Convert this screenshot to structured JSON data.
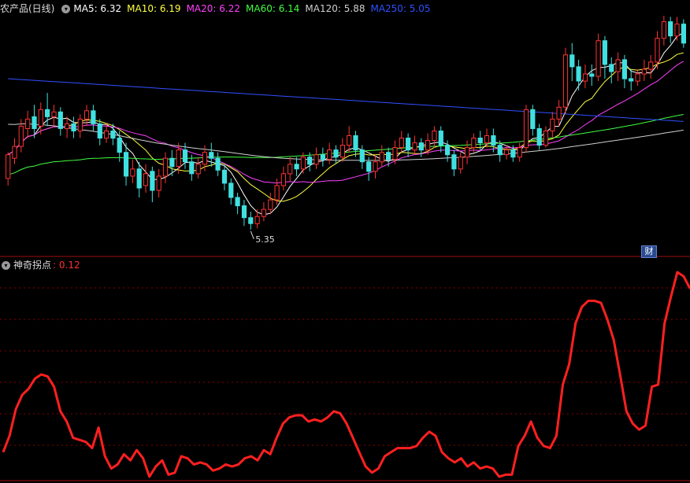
{
  "header": {
    "stock_title": "农产品(日线)",
    "ma_labels": [
      {
        "text": "MA5: 6.32",
        "color": "#ffffff"
      },
      {
        "text": "MA10: 6.19",
        "color": "#ffff40"
      },
      {
        "text": "MA20: 6.22",
        "color": "#ff40ff"
      },
      {
        "text": "MA60: 6.14",
        "color": "#40ff40"
      },
      {
        "text": "MA120: 5.88",
        "color": "#d0d0d0"
      },
      {
        "text": "MA250: 5.05",
        "color": "#3050ff"
      }
    ]
  },
  "indicator": {
    "name": "神奇拐点",
    "value_text": ": 0.12",
    "color": "#ff2020"
  },
  "badge": {
    "label": "财"
  },
  "colors": {
    "up": "#ff3333",
    "down": "#40e0e0",
    "grid": "#8b0000",
    "ma5": "#ffffff",
    "ma10": "#ffff40",
    "ma20": "#ff40ff",
    "ma60": "#40ff40",
    "ma120": "#d0d0d0",
    "ma250": "#3050ff"
  },
  "chart_data": [
    {
      "type": "candlestick",
      "price_range": [
        5.15,
        7.15
      ],
      "low_marker": {
        "label": "5.35",
        "value": 5.35
      },
      "candles": [
        [
          5.78,
          5.98,
          5.72,
          6.0
        ],
        [
          5.95,
          6.05,
          5.9,
          6.12
        ],
        [
          6.05,
          6.22,
          6.0,
          6.28
        ],
        [
          6.2,
          6.28,
          6.12,
          6.35
        ],
        [
          6.3,
          6.2,
          6.12,
          6.4
        ],
        [
          6.22,
          6.36,
          6.15,
          6.42
        ],
        [
          6.36,
          6.3,
          6.22,
          6.5
        ],
        [
          6.3,
          6.34,
          6.22,
          6.4
        ],
        [
          6.34,
          6.2,
          6.14,
          6.38
        ],
        [
          6.2,
          6.24,
          6.12,
          6.3
        ],
        [
          6.24,
          6.18,
          6.12,
          6.3
        ],
        [
          6.18,
          6.28,
          6.12,
          6.32
        ],
        [
          6.28,
          6.35,
          6.22,
          6.4
        ],
        [
          6.35,
          6.24,
          6.18,
          6.4
        ],
        [
          6.24,
          6.12,
          6.06,
          6.28
        ],
        [
          6.12,
          6.18,
          6.08,
          6.24
        ],
        [
          6.18,
          6.12,
          6.06,
          6.24
        ],
        [
          6.12,
          6.0,
          5.92,
          6.18
        ],
        [
          6.0,
          5.8,
          5.72,
          6.08
        ],
        [
          5.8,
          5.86,
          5.74,
          5.94
        ],
        [
          5.86,
          5.7,
          5.62,
          5.92
        ],
        [
          5.72,
          5.82,
          5.66,
          5.9
        ],
        [
          5.84,
          5.68,
          5.58,
          5.88
        ],
        [
          5.68,
          5.8,
          5.62,
          5.86
        ],
        [
          5.8,
          5.95,
          5.74,
          6.0
        ],
        [
          5.95,
          5.88,
          5.8,
          6.02
        ],
        [
          5.88,
          6.02,
          5.82,
          6.08
        ],
        [
          6.02,
          5.92,
          5.86,
          6.08
        ],
        [
          5.92,
          5.82,
          5.76,
          5.98
        ],
        [
          5.82,
          5.9,
          5.78,
          5.96
        ],
        [
          5.9,
          6.0,
          5.84,
          6.06
        ],
        [
          6.0,
          5.95,
          5.88,
          6.08
        ],
        [
          5.95,
          5.85,
          5.8,
          6.0
        ],
        [
          5.85,
          5.74,
          5.68,
          5.9
        ],
        [
          5.74,
          5.62,
          5.56,
          5.78
        ],
        [
          5.62,
          5.55,
          5.48,
          5.66
        ],
        [
          5.55,
          5.45,
          5.38,
          5.6
        ],
        [
          5.45,
          5.4,
          5.35,
          5.5
        ],
        [
          5.4,
          5.46,
          5.36,
          5.52
        ],
        [
          5.46,
          5.52,
          5.42,
          5.58
        ],
        [
          5.52,
          5.6,
          5.48,
          5.66
        ],
        [
          5.6,
          5.72,
          5.56,
          5.78
        ],
        [
          5.72,
          5.82,
          5.68,
          5.88
        ],
        [
          5.82,
          5.9,
          5.76,
          5.96
        ],
        [
          5.9,
          5.86,
          5.8,
          5.96
        ],
        [
          5.86,
          5.96,
          5.82,
          6.0
        ],
        [
          5.96,
          5.9,
          5.84,
          6.0
        ],
        [
          5.9,
          5.98,
          5.86,
          6.04
        ],
        [
          5.98,
          5.94,
          5.88,
          6.04
        ],
        [
          5.94,
          6.02,
          5.9,
          6.08
        ],
        [
          6.02,
          5.96,
          5.9,
          6.06
        ],
        [
          5.96,
          6.06,
          5.92,
          6.12
        ],
        [
          6.06,
          6.14,
          6.0,
          6.22
        ],
        [
          6.14,
          6.02,
          5.96,
          6.18
        ],
        [
          6.02,
          5.92,
          5.86,
          6.06
        ],
        [
          5.92,
          5.84,
          5.76,
          5.96
        ],
        [
          5.84,
          5.92,
          5.78,
          5.98
        ],
        [
          5.92,
          6.0,
          5.88,
          6.06
        ],
        [
          6.0,
          5.94,
          5.88,
          6.04
        ],
        [
          5.94,
          6.04,
          5.9,
          6.1
        ],
        [
          6.04,
          6.12,
          6.0,
          6.18
        ],
        [
          6.12,
          6.02,
          5.96,
          6.16
        ],
        [
          6.02,
          6.08,
          5.98,
          6.14
        ],
        [
          6.08,
          6.02,
          5.96,
          6.12
        ],
        [
          6.02,
          6.1,
          5.98,
          6.16
        ],
        [
          6.1,
          6.18,
          6.04,
          6.22
        ],
        [
          6.18,
          6.06,
          6.0,
          6.22
        ],
        [
          6.06,
          5.98,
          5.92,
          6.1
        ],
        [
          5.98,
          5.86,
          5.8,
          6.02
        ],
        [
          5.86,
          5.96,
          5.82,
          6.0
        ],
        [
          5.96,
          6.04,
          5.9,
          6.1
        ],
        [
          6.04,
          6.12,
          6.0,
          6.16
        ],
        [
          6.12,
          6.08,
          6.02,
          6.18
        ],
        [
          6.08,
          6.14,
          6.04,
          6.2
        ],
        [
          6.14,
          6.06,
          6.0,
          6.2
        ],
        [
          6.06,
          5.98,
          5.92,
          6.1
        ],
        [
          5.98,
          6.02,
          5.94,
          6.06
        ],
        [
          6.02,
          5.96,
          5.92,
          6.06
        ],
        [
          5.96,
          6.04,
          5.92,
          6.08
        ],
        [
          6.04,
          6.36,
          6.0,
          6.4
        ],
        [
          6.36,
          6.2,
          6.14,
          6.4
        ],
        [
          6.2,
          6.06,
          6.02,
          6.24
        ],
        [
          6.06,
          6.18,
          6.04,
          6.22
        ],
        [
          6.18,
          6.28,
          6.12,
          6.34
        ],
        [
          6.28,
          6.38,
          6.22,
          6.44
        ],
        [
          6.38,
          6.82,
          6.32,
          6.88
        ],
        [
          6.82,
          6.72,
          6.6,
          6.92
        ],
        [
          6.72,
          6.6,
          6.52,
          6.78
        ],
        [
          6.6,
          6.66,
          6.54,
          6.74
        ],
        [
          6.66,
          6.64,
          6.56,
          6.74
        ],
        [
          6.64,
          6.94,
          6.6,
          7.0
        ],
        [
          6.94,
          6.74,
          6.62,
          6.98
        ],
        [
          6.74,
          6.68,
          6.58,
          6.8
        ],
        [
          6.68,
          6.78,
          6.6,
          6.84
        ],
        [
          6.78,
          6.62,
          6.54,
          6.82
        ],
        [
          6.62,
          6.6,
          6.52,
          6.7
        ],
        [
          6.6,
          6.66,
          6.56,
          6.7
        ],
        [
          6.66,
          6.7,
          6.6,
          6.78
        ],
        [
          6.7,
          6.76,
          6.62,
          6.82
        ],
        [
          6.76,
          6.96,
          6.7,
          7.02
        ],
        [
          6.96,
          7.1,
          6.9,
          7.15
        ],
        [
          7.1,
          6.98,
          6.92,
          7.14
        ],
        [
          6.98,
          7.08,
          6.94,
          7.14
        ],
        [
          7.08,
          6.92,
          6.88,
          7.12
        ]
      ]
    },
    {
      "type": "line",
      "name": "神奇拐点",
      "last_value": 0.12,
      "values": [
        0.12,
        0.2,
        0.33,
        0.4,
        0.43,
        0.48,
        0.5,
        0.49,
        0.44,
        0.32,
        0.27,
        0.19,
        0.18,
        0.17,
        0.14,
        0.24,
        0.1,
        0.04,
        0.06,
        0.11,
        0.08,
        0.13,
        0.09,
        0.0,
        0.05,
        0.08,
        0.01,
        0.02,
        0.1,
        0.09,
        0.06,
        0.07,
        0.06,
        0.03,
        0.04,
        0.06,
        0.05,
        0.06,
        0.09,
        0.1,
        0.08,
        0.13,
        0.11,
        0.19,
        0.26,
        0.29,
        0.3,
        0.3,
        0.27,
        0.28,
        0.27,
        0.29,
        0.32,
        0.31,
        0.26,
        0.19,
        0.12,
        0.05,
        0.02,
        0.04,
        0.1,
        0.12,
        0.14,
        0.14,
        0.14,
        0.15,
        0.19,
        0.22,
        0.2,
        0.12,
        0.09,
        0.07,
        0.09,
        0.05,
        0.07,
        0.04,
        0.05,
        0.04,
        0.0,
        0.01,
        0.01,
        0.15,
        0.2,
        0.27,
        0.19,
        0.15,
        0.14,
        0.2,
        0.45,
        0.55,
        0.75,
        0.83,
        0.86,
        0.86,
        0.85,
        0.77,
        0.67,
        0.5,
        0.32,
        0.26,
        0.23,
        0.25,
        0.44,
        0.45,
        0.75,
        0.88,
        1.0,
        0.98,
        0.92
      ]
    }
  ]
}
